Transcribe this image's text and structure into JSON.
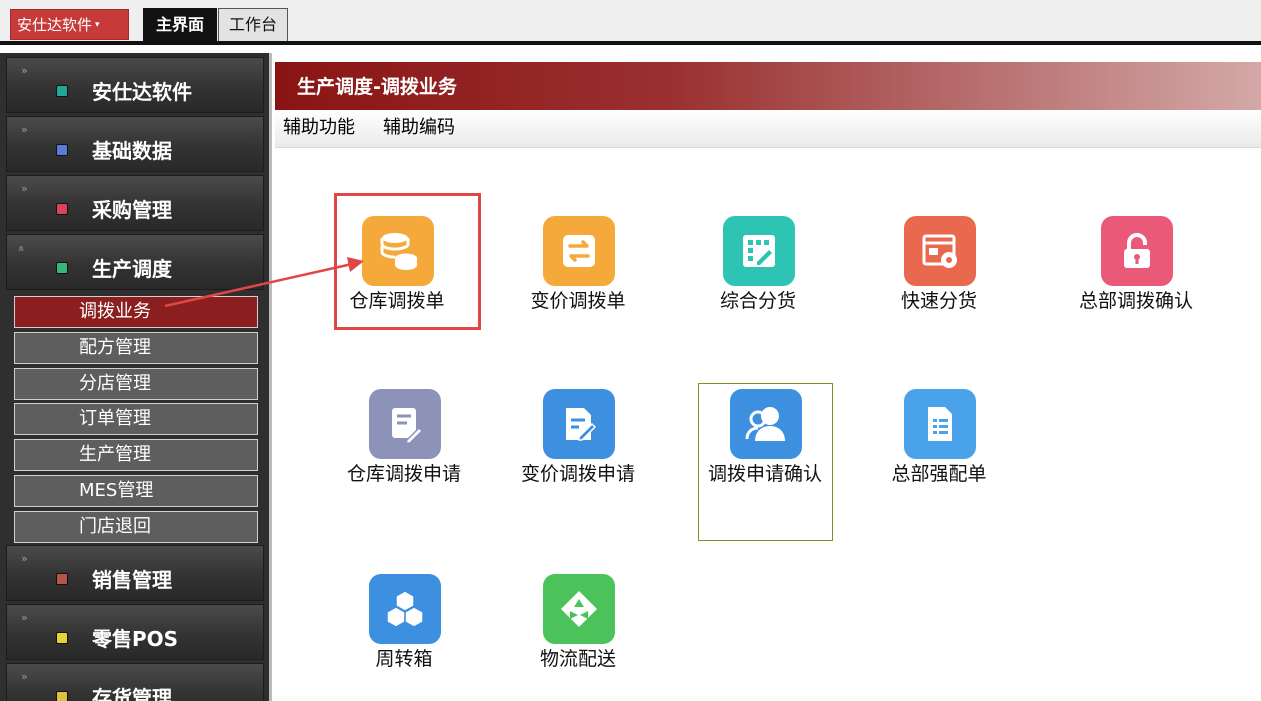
{
  "topbar": {
    "app_menu_label": "安仕达软件",
    "app_menu_caret": "▾",
    "tabs": [
      {
        "label": "主界面",
        "active": true
      },
      {
        "label": "工作台",
        "active": false
      }
    ]
  },
  "sidebar": {
    "groups": [
      {
        "label": "安仕达软件",
        "chevron": "»",
        "icon_color": "#1fa89a"
      },
      {
        "label": "基础数据",
        "chevron": "»",
        "icon_color": "#5b7bd8"
      },
      {
        "label": "采购管理",
        "chevron": "»",
        "icon_color": "#d9445a"
      },
      {
        "label": "生产调度",
        "chevron": "«",
        "icon_color": "#38b67a"
      },
      {
        "label": "销售管理",
        "chevron": "»",
        "icon_color": "#b5564a"
      },
      {
        "label": "零售POS",
        "chevron": "»",
        "icon_color": "#e8d23a"
      },
      {
        "label": "存货管理",
        "chevron": "»",
        "icon_color": "#e0c040"
      }
    ],
    "subitems": [
      {
        "label": "调拨业务",
        "active": true
      },
      {
        "label": "配方管理",
        "active": false
      },
      {
        "label": "分店管理",
        "active": false
      },
      {
        "label": "订单管理",
        "active": false
      },
      {
        "label": "生产管理",
        "active": false
      },
      {
        "label": "MES管理",
        "active": false
      },
      {
        "label": "门店退回",
        "active": false
      }
    ]
  },
  "content": {
    "title": "生产调度-调拨业务",
    "menu": [
      "辅助功能",
      "辅助编码"
    ],
    "tiles": [
      {
        "label": "仓库调拨单",
        "icon": "coins-stack-icon",
        "color": "#f5a93b"
      },
      {
        "label": "变价调拨单",
        "icon": "swap-arrows-icon",
        "color": "#f5a93b"
      },
      {
        "label": "综合分货",
        "icon": "grid-edit-icon",
        "color": "#2ec4b3"
      },
      {
        "label": "快速分货",
        "icon": "window-gear-icon",
        "color": "#e9694f"
      },
      {
        "label": "总部调拨确认",
        "icon": "unlock-icon",
        "color": "#ea5a78"
      },
      {
        "label": "仓库调拨申请",
        "icon": "document-pen-icon",
        "color": "#8d92b8"
      },
      {
        "label": "变价调拨申请",
        "icon": "edit-document-icon",
        "color": "#3d8fe0"
      },
      {
        "label": "调拨申请确认",
        "icon": "users-icon",
        "color": "#3d8fe0"
      },
      {
        "label": "总部强配单",
        "icon": "list-document-icon",
        "color": "#4aa3ea"
      },
      {
        "label": "周转箱",
        "icon": "cubes-icon",
        "color": "#3d8fe0"
      },
      {
        "label": "物流配送",
        "icon": "recycle-icon",
        "color": "#4cc35a"
      }
    ]
  }
}
